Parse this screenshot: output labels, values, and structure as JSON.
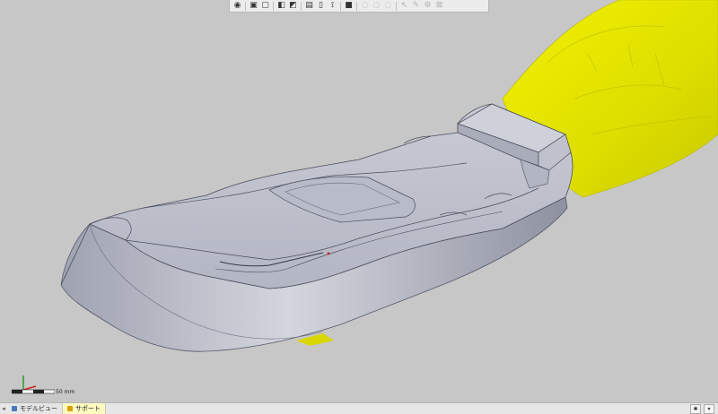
{
  "toolbar": {
    "buttons": [
      {
        "icon": "view-sphere-icon",
        "glyph": "◉",
        "enabled": true
      },
      {
        "icon": "cube-shaded-icon",
        "glyph": "▣",
        "enabled": true
      },
      {
        "icon": "cube-wire-icon",
        "glyph": "▢",
        "enabled": true
      },
      {
        "icon": "section-icon",
        "glyph": "◧",
        "enabled": true
      },
      {
        "icon": "flip-view-icon",
        "glyph": "◩",
        "enabled": true
      },
      {
        "icon": "page-icon",
        "glyph": "▤",
        "enabled": true
      },
      {
        "icon": "bracket-icon",
        "glyph": "▯",
        "enabled": true
      },
      {
        "icon": "measure-icon",
        "glyph": "⟟",
        "enabled": true
      },
      {
        "icon": "color-map-icon",
        "glyph": "■",
        "enabled": true
      },
      {
        "icon": "circle-1-icon",
        "glyph": "◌",
        "enabled": false
      },
      {
        "icon": "circle-2-icon",
        "glyph": "◌",
        "enabled": false
      },
      {
        "icon": "circle-3-icon",
        "glyph": "◌",
        "enabled": false
      },
      {
        "icon": "pointer-icon",
        "glyph": "↖",
        "enabled": false
      },
      {
        "icon": "pen-icon",
        "glyph": "✎",
        "enabled": false
      },
      {
        "icon": "settings-icon",
        "glyph": "⚙",
        "enabled": false
      },
      {
        "icon": "close-box-icon",
        "glyph": "⊠",
        "enabled": false
      }
    ]
  },
  "viewport": {
    "scale_label": "50 mm",
    "colors": {
      "background": "#c7c7c7",
      "part": "#b9bcc8",
      "scan": "#e8e800",
      "edge": "#4a4c5c"
    }
  },
  "statusbar": {
    "tabs": [
      {
        "label": "モデルビュー",
        "active": false
      },
      {
        "label": "サポート",
        "active": true
      }
    ],
    "right_tools": [
      "✱",
      "▾"
    ]
  }
}
